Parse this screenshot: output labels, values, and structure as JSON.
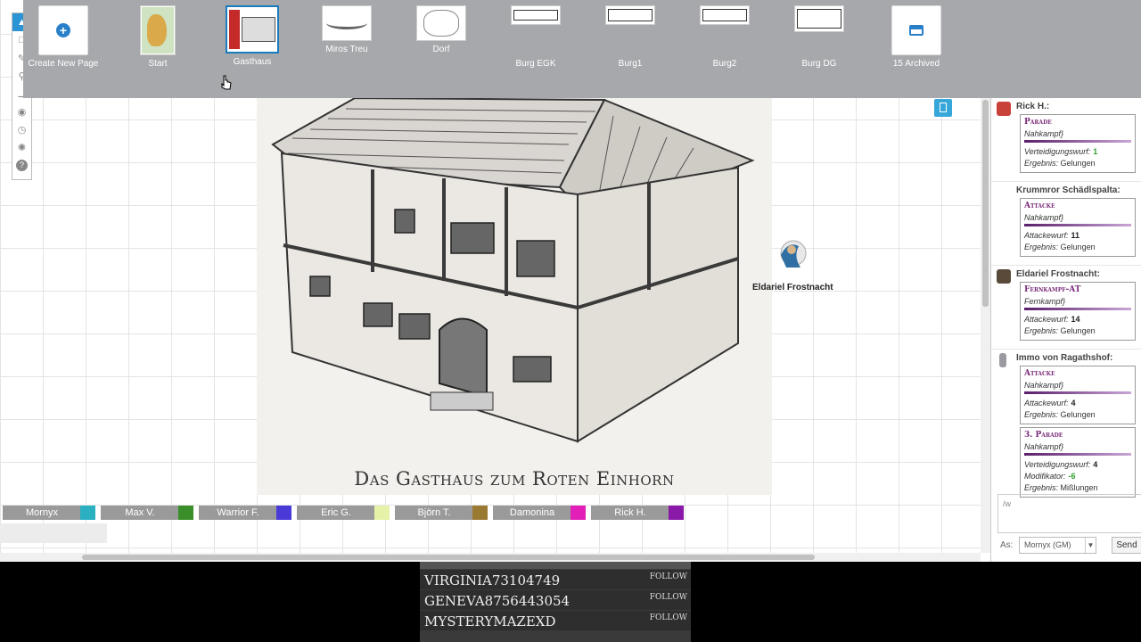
{
  "pages": [
    {
      "label": "Create New Page",
      "icon": "plus-icon"
    },
    {
      "label": "Start"
    },
    {
      "label": "Gasthaus",
      "active": true
    },
    {
      "label": "Miros Treu"
    },
    {
      "label": "Dorf"
    },
    {
      "label": "Burg EGK"
    },
    {
      "label": "Burg1"
    },
    {
      "label": "Burg2"
    },
    {
      "label": "Burg DG"
    },
    {
      "label": "15 Archived",
      "icon": "inbox-icon"
    }
  ],
  "map": {
    "caption": "Das Gasthaus zum Roten Einhorn",
    "token_label": "Eldariel Frostnacht"
  },
  "players": [
    {
      "name": "Mornyx",
      "color": "#2bb0c2"
    },
    {
      "name": "Max V.",
      "color": "#3a8f2a"
    },
    {
      "name": "Warrior F.",
      "color": "#4a3ad8"
    },
    {
      "name": "Eric G.",
      "color": "#e6f2a8"
    },
    {
      "name": "Björn T.",
      "color": "#9a7a33"
    },
    {
      "name": "Damonina",
      "color": "#e21fb8"
    },
    {
      "name": "Rick H.",
      "color": "#8a18a8"
    }
  ],
  "chat": {
    "messages": [
      {
        "sender": "Rick H.:",
        "avatar_color": "#c8423a",
        "cards": [
          {
            "title": "Parade",
            "sub": "Nahkampf}",
            "rows": [
              {
                "label": "Verteidigungswurf:",
                "value": "1",
                "green": true
              },
              {
                "label": "Ergebnis:",
                "value": "Gelungen"
              }
            ]
          }
        ]
      },
      {
        "sender": "Krummror Schädlspalta:",
        "avatar_color": "",
        "cards": [
          {
            "title": "Attacke",
            "sub": "Nahkampf}",
            "rows": [
              {
                "label": "Attackewurf:",
                "value": "11"
              },
              {
                "label": "Ergebnis:",
                "value": "Gelungen"
              }
            ]
          }
        ]
      },
      {
        "sender": "Eldariel Frostnacht:",
        "avatar_color": "#5a4a3a",
        "cards": [
          {
            "title": "Fernkampf-AT",
            "sub": "Fernkampf}",
            "rows": [
              {
                "label": "Attackewurf:",
                "value": "14"
              },
              {
                "label": "Ergebnis:",
                "value": "Gelungen"
              }
            ]
          }
        ]
      },
      {
        "sender": "Immo von Ragathshof:",
        "avatar_color": "#9a9aa0",
        "cards": [
          {
            "title": "Attacke",
            "sub": "Nahkampf}",
            "rows": [
              {
                "label": "Attackewurf:",
                "value": "4"
              },
              {
                "label": "Ergebnis:",
                "value": "Gelungen"
              }
            ]
          },
          {
            "title": "3. Parade",
            "sub": "Nahkampf}",
            "rows": [
              {
                "label": "Verteidigungswurf:",
                "value": "4"
              },
              {
                "label": "Modifikator:",
                "value": "-6",
                "green": true
              },
              {
                "label": "Ergebnis:",
                "value": "Mißlungen"
              }
            ]
          }
        ]
      }
    ],
    "input_value": "/w",
    "as_label": "As:",
    "as_selected": "Mornyx (GM)",
    "send_label": "Send"
  },
  "stream": {
    "followers": [
      {
        "name": "VIRGINIA73104749",
        "action": "FOLLOW"
      },
      {
        "name": "GENEVA8756443054",
        "action": "FOLLOW"
      },
      {
        "name": "MYSTERYMAZEXD",
        "action": "FOLLOW"
      }
    ]
  }
}
